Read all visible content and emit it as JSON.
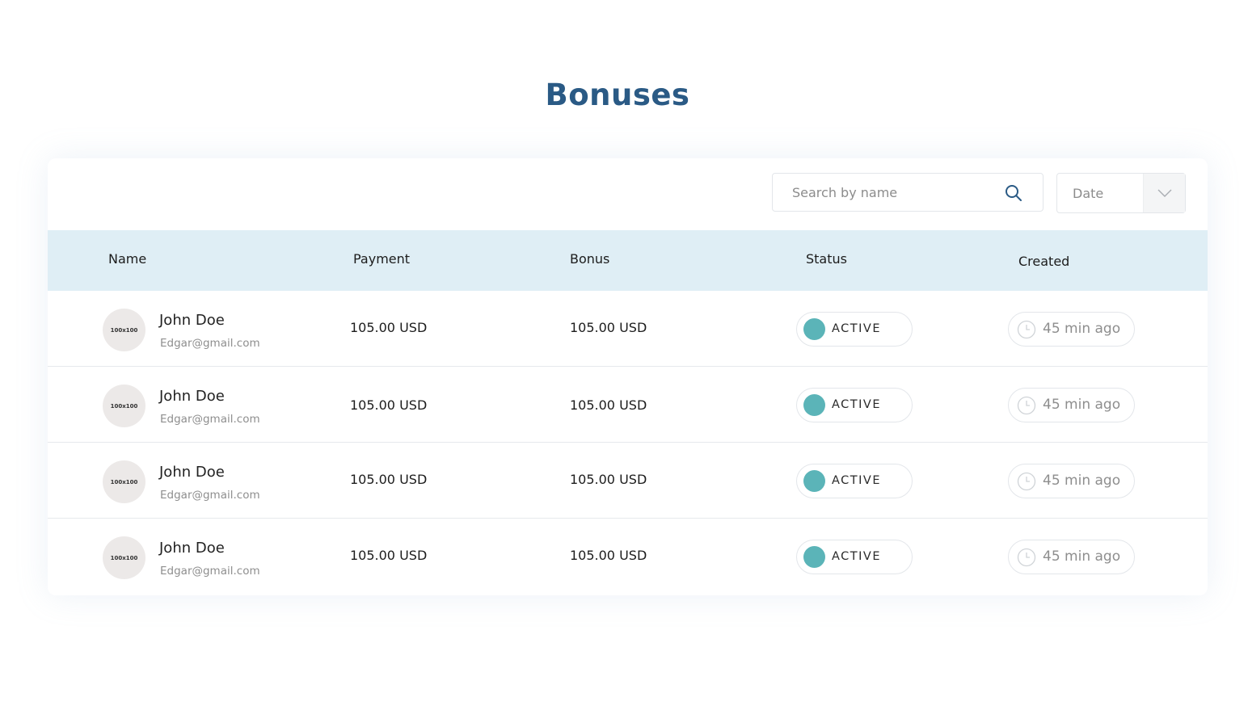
{
  "page": {
    "title": "Bonuses"
  },
  "toolbar": {
    "search_placeholder": "Search by name",
    "search_icon": "search-icon",
    "date_label": "Date",
    "date_icon": "chevron-down-icon"
  },
  "table": {
    "columns": {
      "name": "Name",
      "payment": "Payment",
      "bonus": "Bonus",
      "status": "Status",
      "created": "Created"
    },
    "rows": [
      {
        "avatar": "100x100",
        "name": "John Doe",
        "email": "Edgar@gmail.com",
        "payment": "105.00 USD",
        "bonus": "105.00 USD",
        "status": "ACTIVE",
        "created": "45 min ago"
      },
      {
        "avatar": "100x100",
        "name": "John Doe",
        "email": "Edgar@gmail.com",
        "payment": "105.00 USD",
        "bonus": "105.00 USD",
        "status": "ACTIVE",
        "created": "45 min ago"
      },
      {
        "avatar": "100x100",
        "name": "John Doe",
        "email": "Edgar@gmail.com",
        "payment": "105.00 USD",
        "bonus": "105.00 USD",
        "status": "ACTIVE",
        "created": "45 min ago"
      },
      {
        "avatar": "100x100",
        "name": "John Doe",
        "email": "Edgar@gmail.com",
        "payment": "105.00 USD",
        "bonus": "105.00 USD",
        "status": "ACTIVE",
        "created": "45 min ago"
      }
    ]
  },
  "colors": {
    "title": "#2a5a85",
    "header_bg": "#dfeef5",
    "status_active": "#5bb4b8"
  }
}
